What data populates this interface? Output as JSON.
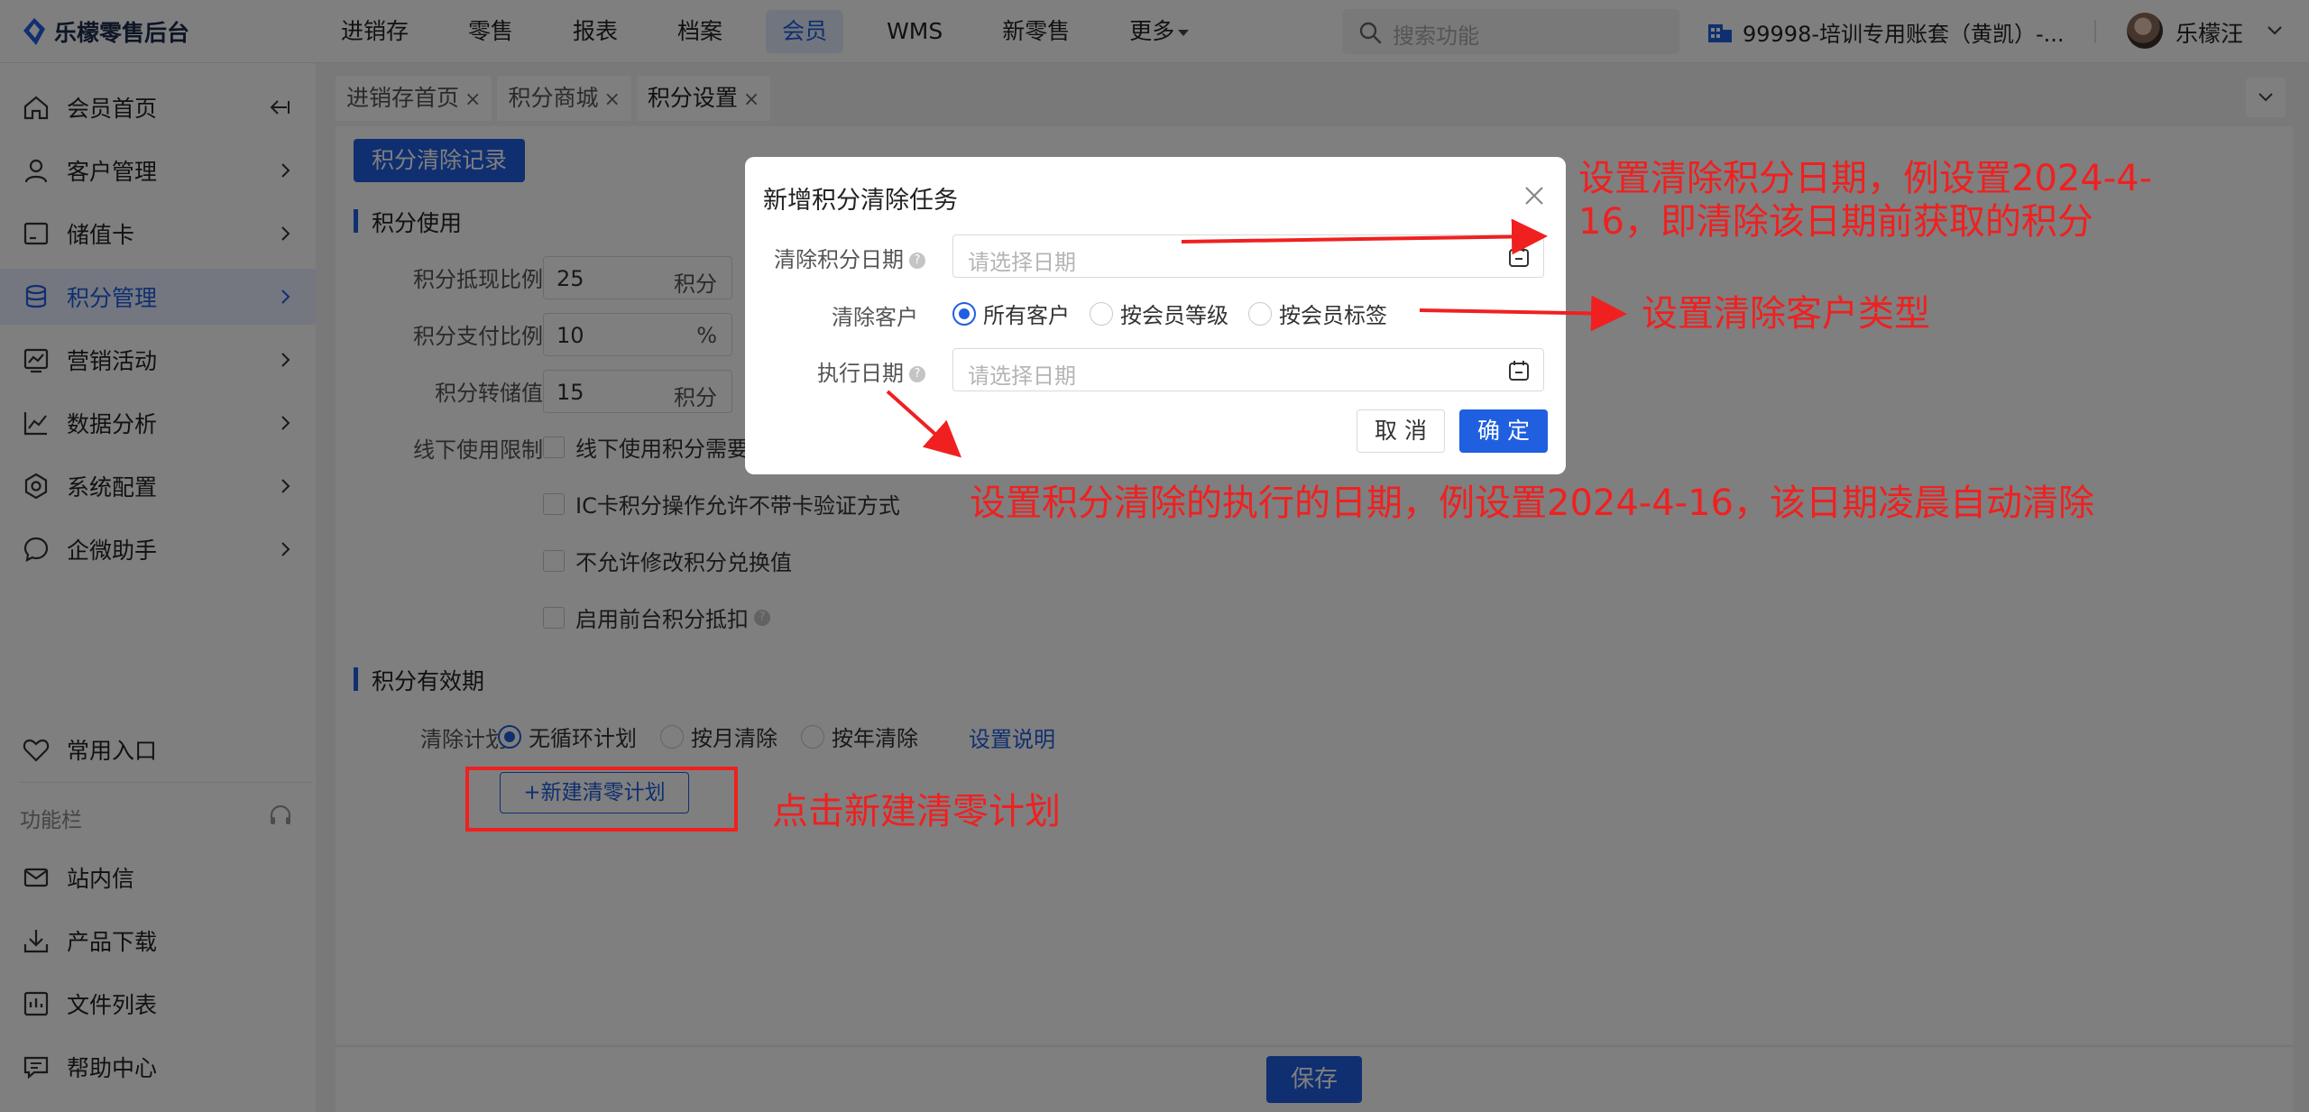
{
  "colors": {
    "accent": "#1f5fe0",
    "annotation": "#f02020"
  },
  "app": {
    "logo_text": "乐檬零售后台"
  },
  "topnav": {
    "items": [
      "进销存",
      "零售",
      "报表",
      "档案",
      "会员",
      "WMS",
      "新零售",
      "更多"
    ],
    "active": "会员"
  },
  "search": {
    "placeholder": "搜索功能"
  },
  "account": {
    "name": "99998-培训专用账套（黄凯）-...",
    "user": "乐檬汪"
  },
  "sidebar": {
    "items": [
      {
        "label": "会员首页",
        "icon": "home-icon"
      },
      {
        "label": "客户管理",
        "icon": "user-icon"
      },
      {
        "label": "储值卡",
        "icon": "card-icon"
      },
      {
        "label": "积分管理",
        "icon": "database-icon"
      },
      {
        "label": "营销活动",
        "icon": "chart-icon"
      },
      {
        "label": "数据分析",
        "icon": "line-chart-icon"
      },
      {
        "label": "系统配置",
        "icon": "settings-icon"
      },
      {
        "label": "企微助手",
        "icon": "chat-icon"
      }
    ],
    "common": "常用入口",
    "section": "功能栏",
    "bottom": [
      "站内信",
      "产品下载",
      "文件列表",
      "帮助中心"
    ]
  },
  "tabs": [
    "进销存首页",
    "积分商城",
    "积分设置"
  ],
  "content": {
    "clear_record_btn": "积分清除记录",
    "section_use": "积分使用",
    "fields": [
      {
        "label": "积分抵现比例",
        "value": "25",
        "unit": "积分"
      },
      {
        "label": "积分支付比例",
        "value": "10",
        "unit": "%"
      },
      {
        "label": "积分转储值",
        "value": "15",
        "unit": "积分"
      }
    ],
    "offline_label": "线下使用限制",
    "checkboxes": [
      "线下使用积分需要",
      "IC卡积分操作允许不带卡验证方式",
      "不允许修改积分兑换值",
      "启用前台积分抵扣"
    ],
    "section_validity": "积分有效期",
    "plan_label": "清除计划",
    "plan_options": [
      "无循环计划",
      "按月清除",
      "按年清除"
    ],
    "plan_link": "设置说明",
    "new_plan_btn": "+新建清零计划",
    "save": "保存"
  },
  "modal": {
    "title": "新增积分清除任务",
    "clear_date_label": "清除积分日期",
    "clear_date_placeholder": "请选择日期",
    "customer_label": "清除客户",
    "customer_options": [
      "所有客户",
      "按会员等级",
      "按会员标签"
    ],
    "exec_date_label": "执行日期",
    "exec_date_placeholder": "请选择日期",
    "cancel": "取 消",
    "ok": "确 定"
  },
  "annotations": {
    "a1": "设置清除积分日期，例设置2024-4-16，即清除该日期前获取的积分",
    "a2": "设置清除客户类型",
    "a3": "设置积分清除的执行的日期，例设置2024-4-16，该日期凌晨自动清除",
    "a4": "点击新建清零计划"
  }
}
